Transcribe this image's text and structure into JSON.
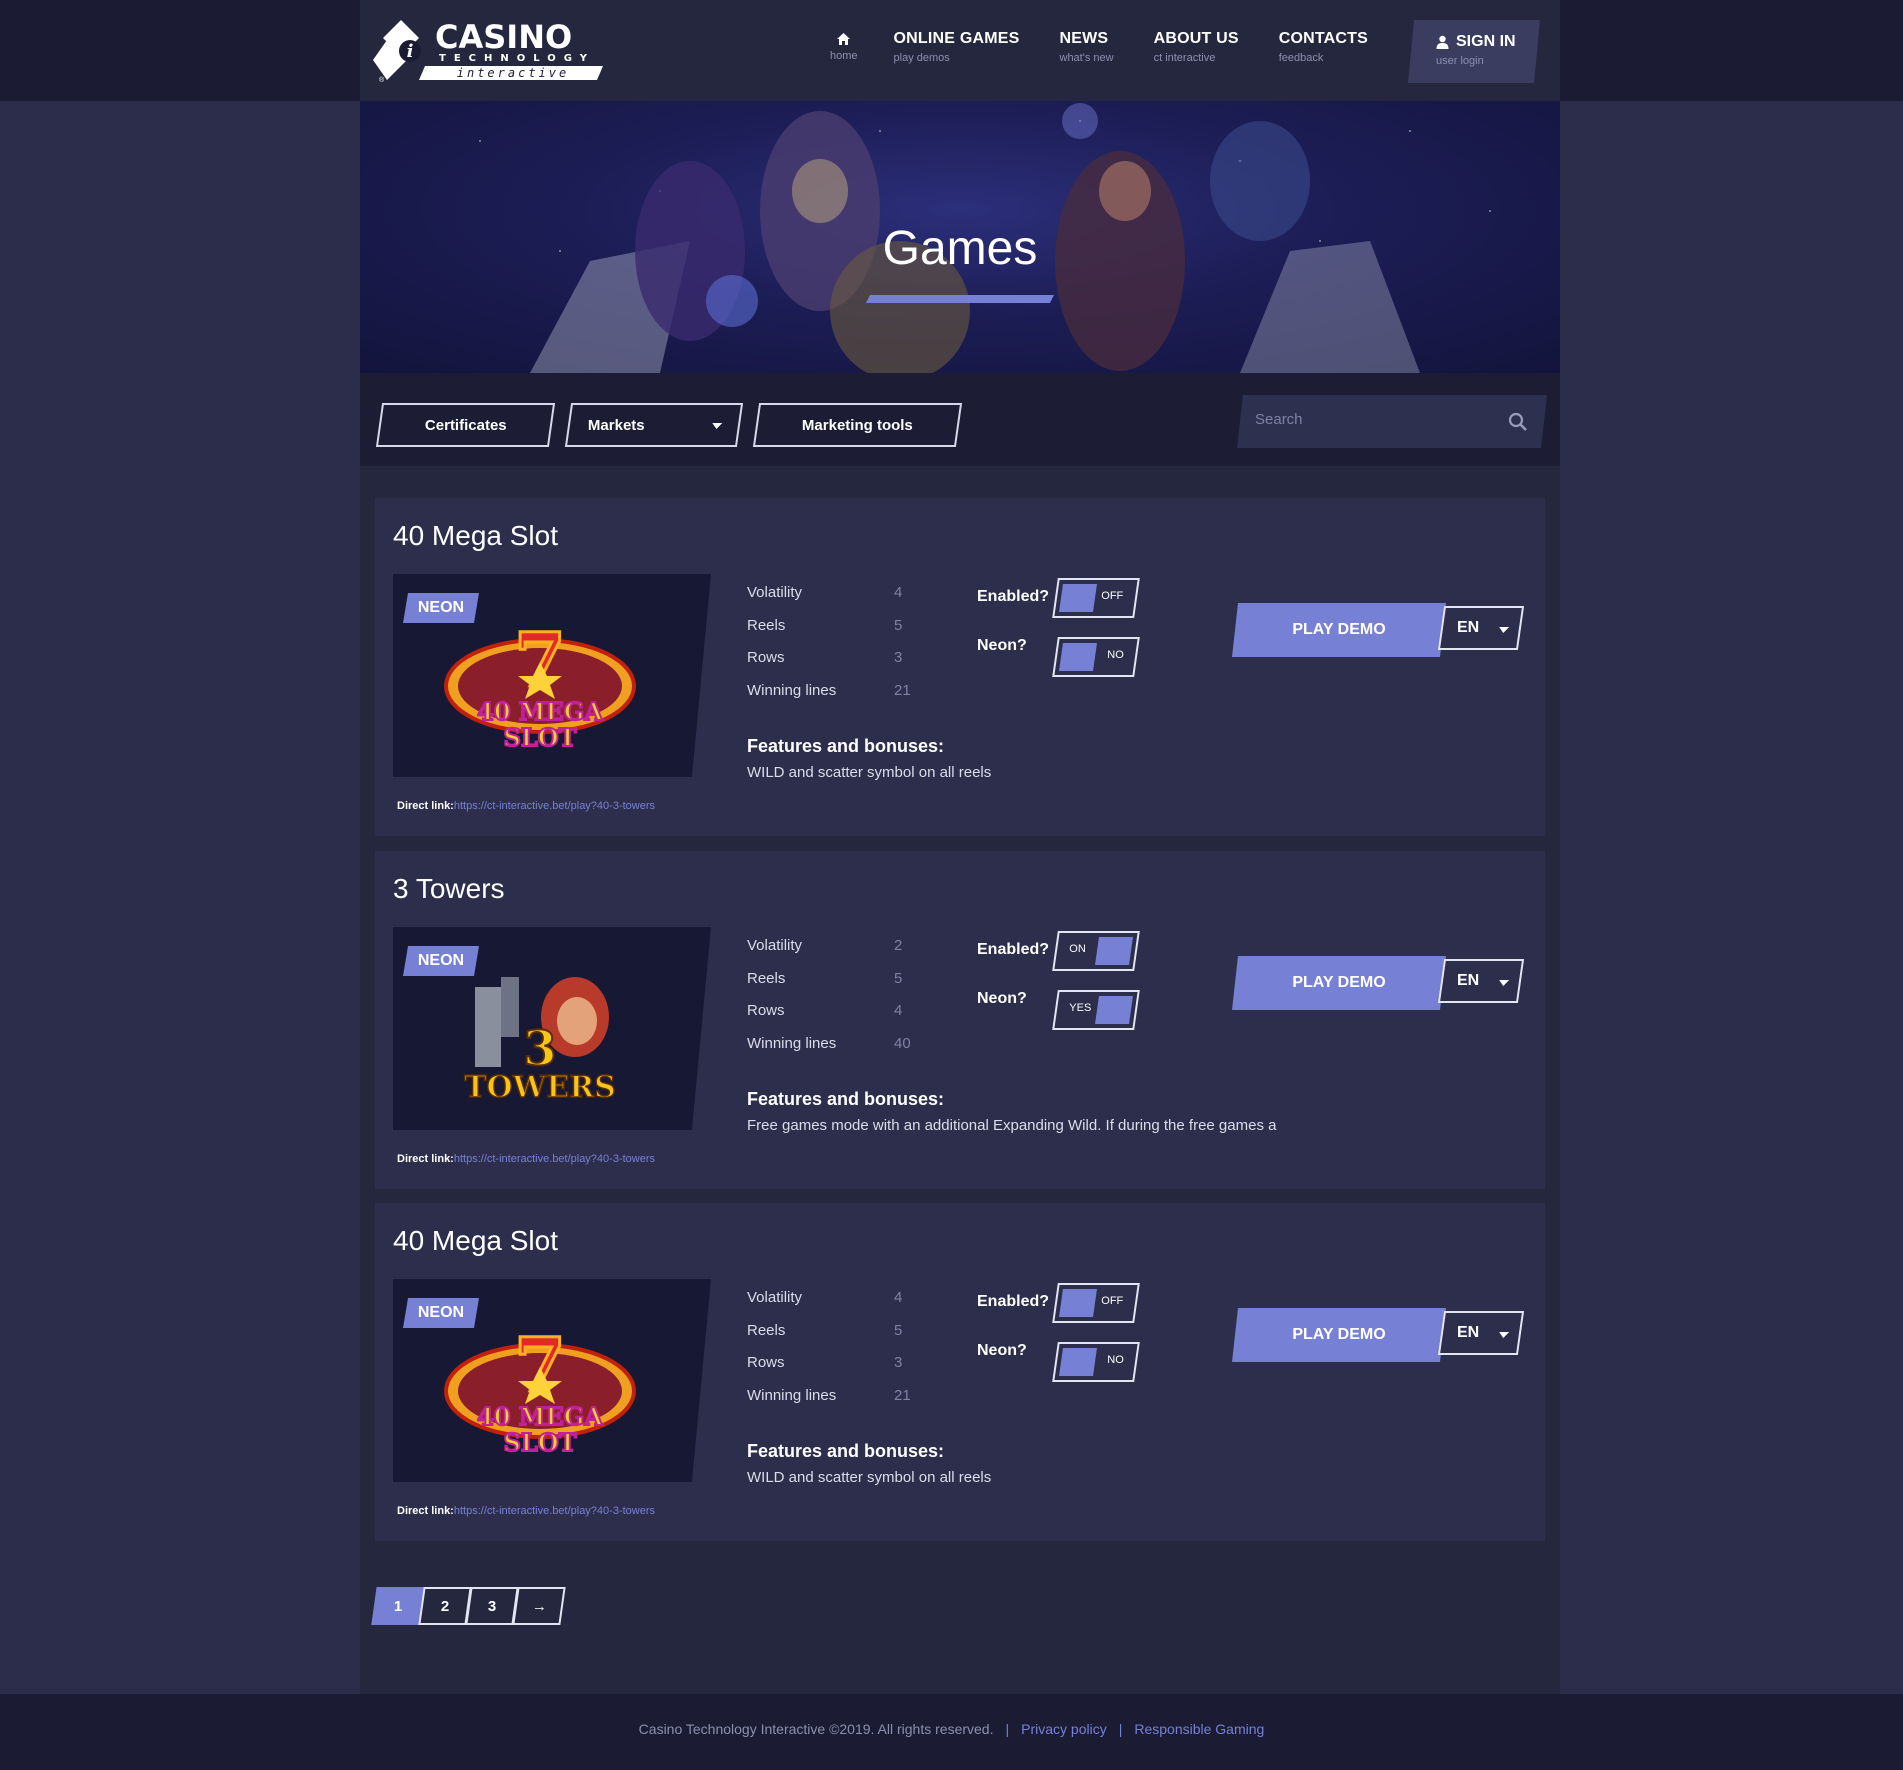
{
  "brand": {
    "logo_main": "CASINO",
    "logo_sub": "TECHNOLOGY",
    "logo_tag": "interactive"
  },
  "nav": [
    {
      "label": "",
      "sub": "home",
      "icon": "home-icon"
    },
    {
      "label": "ONLINE GAMES",
      "sub": "play demos"
    },
    {
      "label": "NEWS",
      "sub": "what's new"
    },
    {
      "label": "ABOUT US",
      "sub": "ct interactive"
    },
    {
      "label": "CONTACTS",
      "sub": "feedback"
    }
  ],
  "signin": {
    "label": "SIGN IN",
    "sub": "user login",
    "icon": "user-icon"
  },
  "hero": {
    "title": "Games"
  },
  "toolbar": {
    "certificates": "Certificates",
    "markets": "Markets",
    "marketing": "Marketing tools",
    "search_placeholder": "Search"
  },
  "spec_labels": {
    "volatility": "Volatility",
    "reels": "Reels",
    "rows": "Rows",
    "lines": "Winning lines"
  },
  "labels": {
    "features": "Features and bonuses:",
    "enabled": "Enabled?",
    "neon": "Neon?",
    "play_demo": "PLAY DEMO",
    "direct_link": "Direct link:",
    "badge": "NEON"
  },
  "games": [
    {
      "title": "40 Mega Slot",
      "volatility": "4",
      "reels": "5",
      "rows": "3",
      "lines": "21",
      "features": "WILD and scatter symbol on all reels",
      "enabled": "OFF",
      "neon": "NO",
      "lang": "EN",
      "link": "https://ct-interactive.bet/play?40-3-towers",
      "art": "40 MEGA SLOT"
    },
    {
      "title": "3 Towers",
      "volatility": "2",
      "reels": "5",
      "rows": "4",
      "lines": "40",
      "features": "Free games mode with an additional Expanding Wild. If during the free games a",
      "enabled": "ON",
      "neon": "YES",
      "lang": "EN",
      "link": "https://ct-interactive.bet/play?40-3-towers",
      "art": "3 TOWERS"
    },
    {
      "title": "40 Mega Slot",
      "volatility": "4",
      "reels": "5",
      "rows": "3",
      "lines": "21",
      "features": "WILD and scatter symbol on all reels",
      "enabled": "OFF",
      "neon": "NO",
      "lang": "EN",
      "link": "https://ct-interactive.bet/play?40-3-towers",
      "art": "40 MEGA SLOT"
    }
  ],
  "pagination": {
    "pages": [
      "1",
      "2",
      "3"
    ],
    "current": "1",
    "next": "→"
  },
  "footer": {
    "copyright": "Casino Technology Interactive ©2019. All rights reserved.",
    "privacy": "Privacy policy",
    "responsible": "Responsible Gaming",
    "separator": "|"
  },
  "colors": {
    "accent": "#7681d6",
    "bg": "#2b2d4a",
    "panel": "#2c2e4b",
    "header": "#1b1c33"
  }
}
